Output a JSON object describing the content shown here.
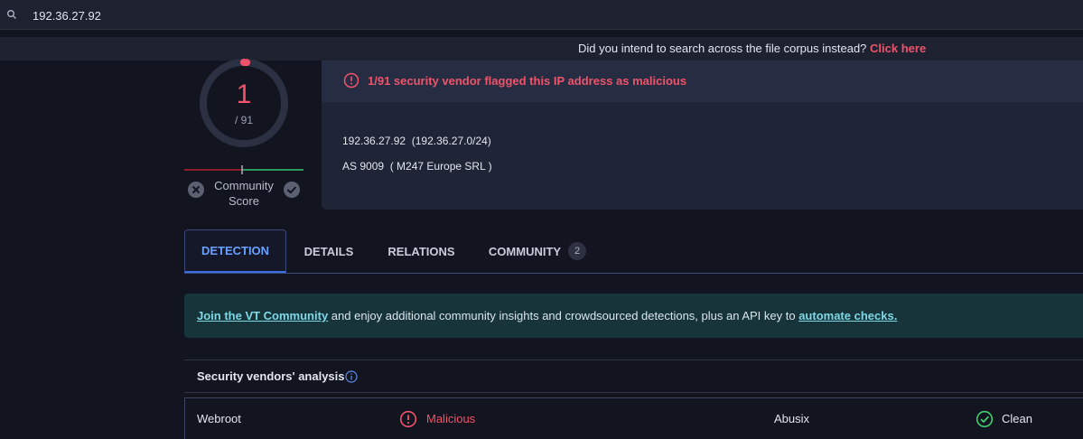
{
  "search": {
    "value": "192.36.27.92",
    "icon": "search-icon"
  },
  "suggestion": {
    "text": "Did you intend to search across the file corpus instead?",
    "link": "Click here",
    "link_color": "#f0536a"
  },
  "score": {
    "detections": "1",
    "total": "/ 91",
    "ring_fraction": 0.011,
    "community_label": "Community Score",
    "community_label_line1": "Community",
    "community_label_line2": "Score"
  },
  "alert": {
    "text": "1/91 security vendor flagged this IP address as malicious"
  },
  "ip": {
    "line": "192.36.27.92  (192.36.27.0/24)"
  },
  "as": {
    "line": "AS 9009  ( M247 Europe SRL )"
  },
  "tabs": [
    {
      "label": "DETECTION",
      "active": true
    },
    {
      "label": "DETAILS"
    },
    {
      "label": "RELATIONS"
    },
    {
      "label": "COMMUNITY",
      "count": "2"
    }
  ],
  "banner": {
    "link1": "Join the VT Community",
    "middle": " and enjoy additional community insights and crowdsourced detections, plus an API key to ",
    "link2": "automate checks."
  },
  "analysis": {
    "title": "Security vendors' analysis",
    "rows": [
      {
        "vendor1": "Webroot",
        "result1": "Malicious",
        "vendor2": "Abusix",
        "result2": "Clean"
      }
    ]
  },
  "colors": {
    "malicious": "#f0536a",
    "clean": "#3ecf6e",
    "accent": "#6aa0ff"
  }
}
